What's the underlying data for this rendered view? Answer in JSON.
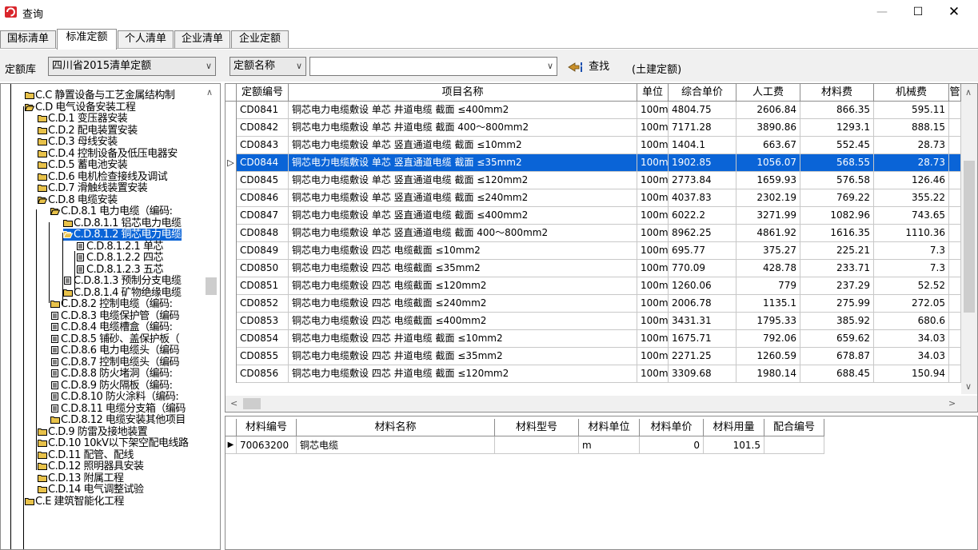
{
  "window": {
    "title": "查询"
  },
  "tabs": [
    "国标清单",
    "标准定额",
    "个人清单",
    "企业清单",
    "企业定额"
  ],
  "toolbar": {
    "quota_lib_label": "定额库",
    "quota_lib_value": "四川省2015清单定额",
    "search_field_value": "定额名称",
    "search_input_value": "",
    "find_label": "查找",
    "category_label": "(土建定额)"
  },
  "tree": [
    {
      "label": "C.C 静置设备与工艺金属结构制",
      "icon": "folder-icon",
      "level": 0
    },
    {
      "label": "C.D 电气设备安装工程",
      "icon": "folder-open-icon",
      "level": 0
    },
    {
      "label": "C.D.1 变压器安装",
      "icon": "folder-icon",
      "level": 1
    },
    {
      "label": "C.D.2 配电装置安装",
      "icon": "folder-icon",
      "level": 1
    },
    {
      "label": "C.D.3 母线安装",
      "icon": "folder-icon",
      "level": 1
    },
    {
      "label": "C.D.4 控制设备及低压电器安",
      "icon": "folder-icon",
      "level": 1
    },
    {
      "label": "C.D.5 蓄电池安装",
      "icon": "folder-icon",
      "level": 1
    },
    {
      "label": "C.D.6 电机检查接线及调试",
      "icon": "folder-icon",
      "level": 1
    },
    {
      "label": "C.D.7 滑触线装置安装",
      "icon": "folder-icon",
      "level": 1
    },
    {
      "label": "C.D.8 电缆安装",
      "icon": "folder-open-icon",
      "level": 1
    },
    {
      "label": "C.D.8.1 电力电缆（编码:",
      "icon": "folder-open-icon",
      "level": 2
    },
    {
      "label": "C.D.8.1.1 铝芯电力电缆",
      "icon": "folder-icon",
      "level": 3
    },
    {
      "label": "C.D.8.1.2 铜芯电力电缆",
      "icon": "folder-open-icon",
      "level": 3,
      "selected": true
    },
    {
      "label": "C.D.8.1.2.1 单芯",
      "icon": "document-icon",
      "level": 4
    },
    {
      "label": "C.D.8.1.2.2 四芯",
      "icon": "document-icon",
      "level": 4
    },
    {
      "label": "C.D.8.1.2.3 五芯",
      "icon": "document-icon",
      "level": 4
    },
    {
      "label": "C.D.8.1.3 预制分支电缆",
      "icon": "document-icon",
      "level": 3
    },
    {
      "label": "C.D.8.1.4 矿物绝缘电缆",
      "icon": "folder-icon",
      "level": 3
    },
    {
      "label": "C.D.8.2 控制电缆（编码:",
      "icon": "folder-icon",
      "level": 2
    },
    {
      "label": "C.D.8.3 电缆保护管（编码",
      "icon": "document-icon",
      "level": 2
    },
    {
      "label": "C.D.8.4 电缆槽盒（编码:",
      "icon": "document-icon",
      "level": 2
    },
    {
      "label": "C.D.8.5 铺砂、盖保护板（",
      "icon": "document-icon",
      "level": 2
    },
    {
      "label": "C.D.8.6 电力电缆头（编码",
      "icon": "document-icon",
      "level": 2
    },
    {
      "label": "C.D.8.7 控制电缆头（编码",
      "icon": "document-icon",
      "level": 2
    },
    {
      "label": "C.D.8.8 防火堵洞（编码:",
      "icon": "document-icon",
      "level": 2
    },
    {
      "label": "C.D.8.9 防火隔板（编码:",
      "icon": "document-icon",
      "level": 2
    },
    {
      "label": "C.D.8.10 防火涂料（编码:",
      "icon": "document-icon",
      "level": 2
    },
    {
      "label": "C.D.8.11 电缆分支箱（编码",
      "icon": "document-icon",
      "level": 2
    },
    {
      "label": "C.D.8.12 电缆安装其他项目",
      "icon": "folder-icon",
      "level": 2
    },
    {
      "label": "C.D.9 防雷及接地装置",
      "icon": "folder-icon",
      "level": 1
    },
    {
      "label": "C.D.10 10kV以下架空配电线路",
      "icon": "folder-icon",
      "level": 1
    },
    {
      "label": "C.D.11 配管、配线",
      "icon": "folder-icon",
      "level": 1
    },
    {
      "label": "C.D.12 照明器具安装",
      "icon": "folder-icon",
      "level": 1
    },
    {
      "label": "C.D.13 附属工程",
      "icon": "folder-icon",
      "level": 1
    },
    {
      "label": "C.D.14 电气调整试验",
      "icon": "folder-icon",
      "level": 1
    },
    {
      "label": "C.E 建筑智能化工程",
      "icon": "folder-icon",
      "level": 0
    }
  ],
  "grid": {
    "columns": [
      "定额编号",
      "项目名称",
      "单位",
      "综合单价",
      "人工费",
      "材料费",
      "机械费",
      "管"
    ],
    "rows": [
      [
        "CD0841",
        "铜芯电力电缆敷设 单芯 井道电缆 截面 ≤400mm2",
        "100m",
        "4804.75",
        "2606.84",
        "866.35",
        "595.11"
      ],
      [
        "CD0842",
        "铜芯电力电缆敷设 单芯 井道电缆 截面 400～800mm2",
        "100m",
        "7171.28",
        "3890.86",
        "1293.1",
        "888.15"
      ],
      [
        "CD0843",
        "铜芯电力电缆敷设 单芯 竖直通道电缆 截面 ≤10mm2",
        "100m",
        "1404.1",
        "663.67",
        "552.45",
        "28.73"
      ],
      [
        "CD0844",
        "铜芯电力电缆敷设 单芯 竖直通道电缆 截面 ≤35mm2",
        "100m",
        "1902.85",
        "1056.07",
        "568.55",
        "28.73"
      ],
      [
        "CD0845",
        "铜芯电力电缆敷设 单芯 竖直通道电缆 截面 ≤120mm2",
        "100m",
        "2773.84",
        "1659.93",
        "576.58",
        "126.46"
      ],
      [
        "CD0846",
        "铜芯电力电缆敷设 单芯 竖直通道电缆 截面 ≤240mm2",
        "100m",
        "4037.83",
        "2302.19",
        "769.22",
        "355.22"
      ],
      [
        "CD0847",
        "铜芯电力电缆敷设 单芯 竖直通道电缆 截面 ≤400mm2",
        "100m",
        "6022.2",
        "3271.99",
        "1082.96",
        "743.65"
      ],
      [
        "CD0848",
        "铜芯电力电缆敷设 单芯 竖直通道电缆 截面 400～800mm2",
        "100m",
        "8962.25",
        "4861.92",
        "1616.35",
        "1110.36"
      ],
      [
        "CD0849",
        "铜芯电力电缆敷设 四芯 电缆截面 ≤10mm2",
        "100m",
        "695.77",
        "375.27",
        "225.21",
        "7.3"
      ],
      [
        "CD0850",
        "铜芯电力电缆敷设 四芯 电缆截面 ≤35mm2",
        "100m",
        "770.09",
        "428.78",
        "233.71",
        "7.3"
      ],
      [
        "CD0851",
        "铜芯电力电缆敷设 四芯 电缆截面 ≤120mm2",
        "100m",
        "1260.06",
        "779",
        "237.29",
        "52.52"
      ],
      [
        "CD0852",
        "铜芯电力电缆敷设 四芯 电缆截面 ≤240mm2",
        "100m",
        "2006.78",
        "1135.1",
        "275.99",
        "272.05"
      ],
      [
        "CD0853",
        "铜芯电力电缆敷设 四芯 电缆截面 ≤400mm2",
        "100m",
        "3431.31",
        "1795.33",
        "385.92",
        "680.6"
      ],
      [
        "CD0854",
        "铜芯电力电缆敷设 四芯 井道电缆 截面 ≤10mm2",
        "100m",
        "1675.71",
        "792.06",
        "659.62",
        "34.03"
      ],
      [
        "CD0855",
        "铜芯电力电缆敷设 四芯 井道电缆 截面 ≤35mm2",
        "100m",
        "2271.25",
        "1260.59",
        "678.87",
        "34.03"
      ],
      [
        "CD0856",
        "铜芯电力电缆敷设 四芯 井道电缆 截面 ≤120mm2",
        "100m",
        "3309.68",
        "1980.14",
        "688.45",
        "150.94"
      ]
    ],
    "selected_index": 3
  },
  "detail": {
    "columns": [
      "材料编号",
      "材料名称",
      "材料型号",
      "材料单位",
      "材料单价",
      "材料用量",
      "配合编号"
    ],
    "rows": [
      [
        "70063200",
        "铜芯电缆",
        "",
        "m",
        "0",
        "101.5",
        ""
      ]
    ]
  },
  "colors": {
    "selection": "#0a64d7",
    "folder": "#e8c24a"
  }
}
